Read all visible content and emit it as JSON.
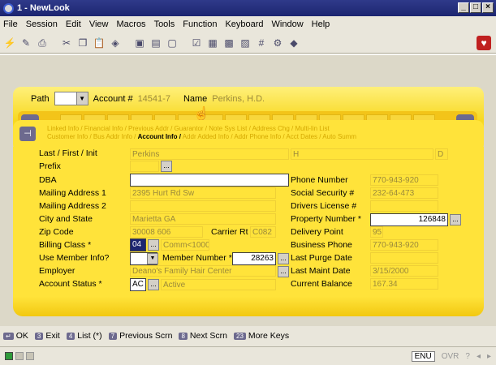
{
  "window": {
    "title": "1 - NewLook"
  },
  "menu": [
    "File",
    "Session",
    "Edit",
    "View",
    "Macros",
    "Tools",
    "Function",
    "Keyboard",
    "Window",
    "Help"
  ],
  "path_bar": {
    "path_label": "Path",
    "account_label": "Account #",
    "account_value": "14541-7",
    "name_label": "Name",
    "name_value": "Perkins, H.D."
  },
  "tabs": {
    "row1": "Linked Info / Financial Info / Previous Addr / Guarantor / Note Sys List / Address Chg / Multi-lin List",
    "row2": "Customer Info / Bus Addr Info / ",
    "active": "Account Info /",
    "row2_after": " Addr Added Info / Addr Phone Info / Acct Dates / Auto Summ"
  },
  "form": {
    "last_first_init_label": "Last / First / Init",
    "last_value": "Perkins",
    "first_value": "H",
    "init_value": "D",
    "prefix_label": "Prefix",
    "dba_label": "DBA",
    "dba_value": "",
    "mailing1_label": "Mailing Address 1",
    "mailing1_value": "2395 Hurt Rd Sw",
    "mailing2_label": "Mailing Address 2",
    "city_state_label": "City and State",
    "city_state_value": "Marietta GA",
    "zip_label": "Zip Code",
    "zip_value": "30008 606",
    "carrier_label": "Carrier Rt",
    "carrier_value": "C082",
    "billing_label": "Billing Class *",
    "billing_code": "04",
    "billing_desc": "Comm<1000",
    "use_member_label": "Use Member Info?",
    "member_num_label": "Member Number *",
    "member_num_value": "28263",
    "employer_label": "Employer",
    "employer_value": "Deano's Family Hair Center",
    "account_status_label": "Account Status *",
    "account_status_code": "AC",
    "account_status_desc": "Active",
    "phone_label": "Phone Number",
    "phone_value": "770-943-920",
    "ssn_label": "Social Security #",
    "ssn_value": "232-64-473",
    "drivers_label": "Drivers License #",
    "drivers_value": "",
    "property_label": "Property Number *",
    "property_value": "126848",
    "delivery_label": "Delivery Point",
    "delivery_value": "95",
    "business_phone_label": "Business Phone",
    "business_phone_value": "770-943-920",
    "last_purge_label": "Last Purge Date",
    "last_purge_value": "",
    "last_maint_label": "Last Maint Date",
    "last_maint_value": "3/15/2000",
    "balance_label": "Current Balance",
    "balance_value": "167.34"
  },
  "fkeys": [
    {
      "num": "",
      "label": "OK"
    },
    {
      "num": "3",
      "label": "Exit"
    },
    {
      "num": "4",
      "label": "List (*)"
    },
    {
      "num": "7",
      "label": "Previous Scrn"
    },
    {
      "num": "8",
      "label": "Next Scrn"
    },
    {
      "num": "23",
      "label": "More Keys"
    }
  ],
  "status": {
    "lang": "ENU",
    "ovr": "OVR",
    "help": "?"
  },
  "colors": {
    "panel": "#ffe33a",
    "titlebar": "#1c2570",
    "nav": "#6d6a8e"
  }
}
